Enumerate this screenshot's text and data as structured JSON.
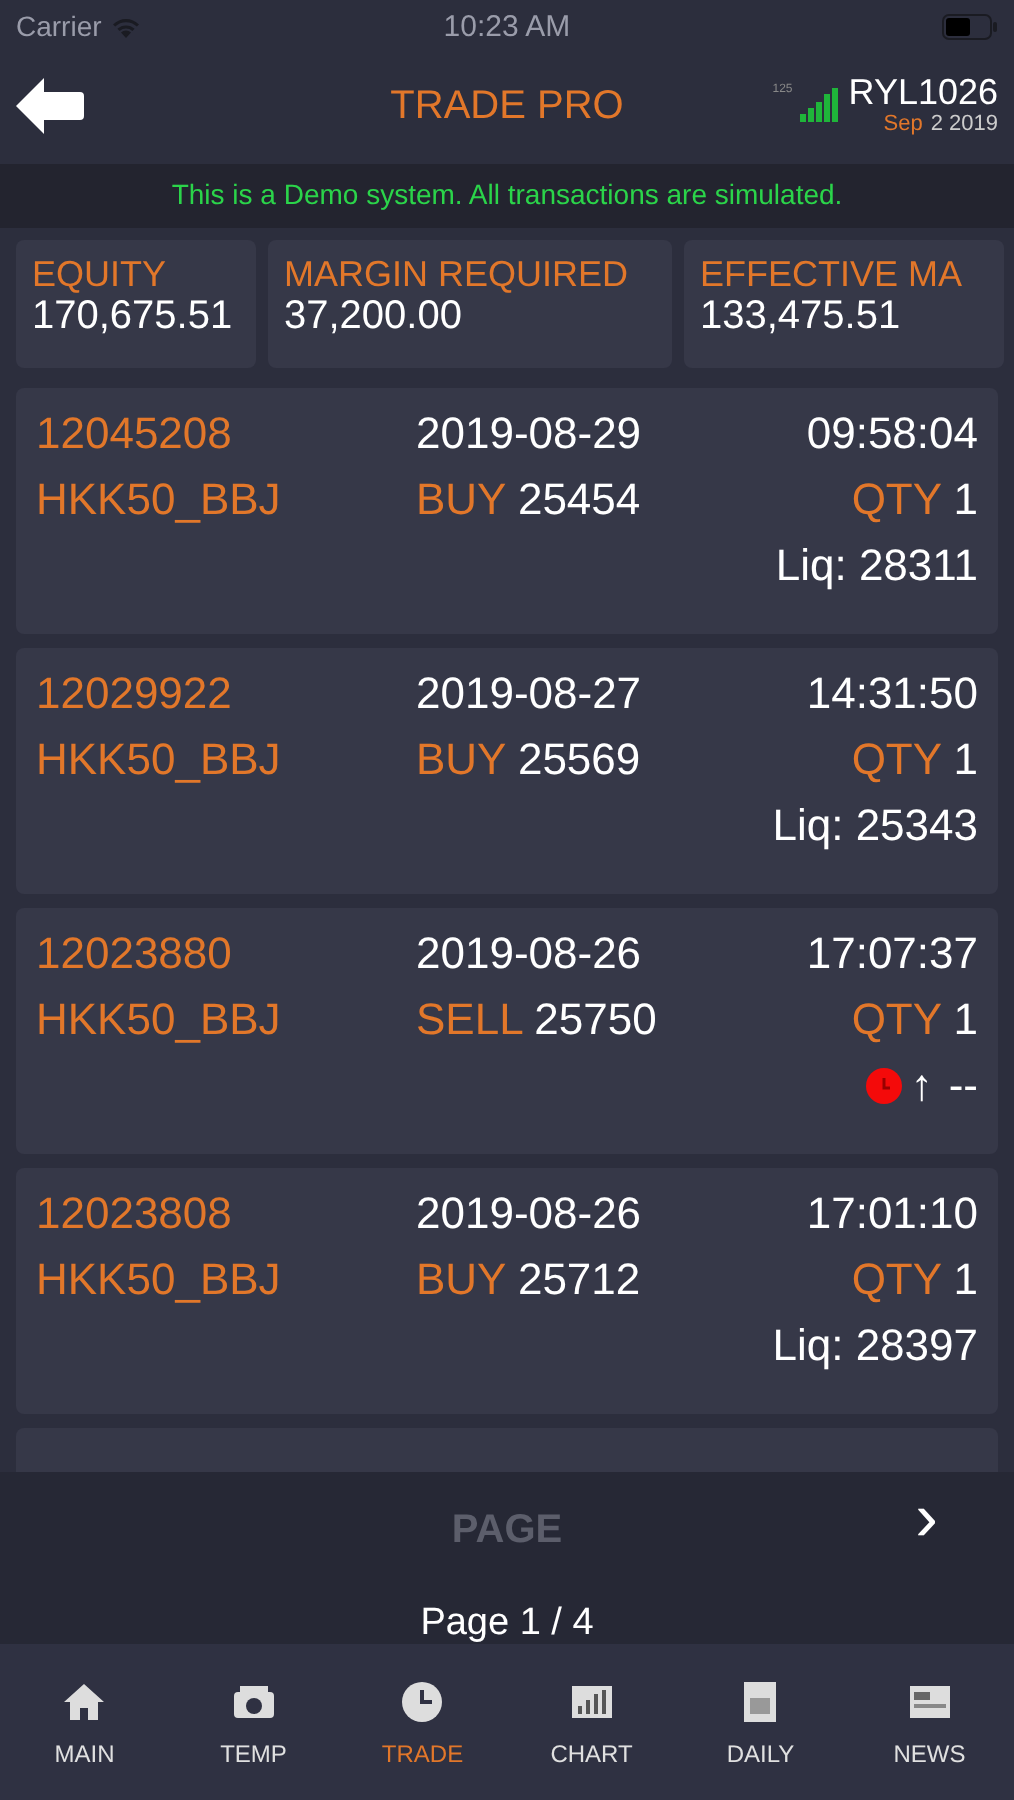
{
  "status_bar": {
    "carrier": "Carrier",
    "time": "10:23 AM"
  },
  "header": {
    "title": "TRADE PRO",
    "signal_value": "125",
    "account": "RYL1026",
    "date_month": "Sep",
    "date_rest": "2 2019"
  },
  "banner": "This is a Demo system. All transactions are simulated.",
  "summary": [
    {
      "label": "EQUITY",
      "value": "170,675.51"
    },
    {
      "label": "MARGIN REQUIRED",
      "value": "37,200.00"
    },
    {
      "label": "EFFECTIVE MA",
      "value": "133,475.51"
    }
  ],
  "trades": [
    {
      "id": "12045208",
      "date": "2019-08-29",
      "time": "09:58:04",
      "symbol": "HKK50_BBJ",
      "side": "BUY",
      "price": "25454",
      "qty_label": "QTY",
      "qty": "1",
      "kind": "liq",
      "liq": "Liq: 28311"
    },
    {
      "id": "12029922",
      "date": "2019-08-27",
      "time": "14:31:50",
      "symbol": "HKK50_BBJ",
      "side": "BUY",
      "price": "25569",
      "qty_label": "QTY",
      "qty": "1",
      "kind": "liq",
      "liq": "Liq: 25343"
    },
    {
      "id": "12023880",
      "date": "2019-08-26",
      "time": "17:07:37",
      "symbol": "HKK50_BBJ",
      "side": "SELL",
      "price": "25750",
      "qty_label": "QTY",
      "qty": "1",
      "kind": "pending",
      "arrow": "↑",
      "liq": "--"
    },
    {
      "id": "12023808",
      "date": "2019-08-26",
      "time": "17:01:10",
      "symbol": "HKK50_BBJ",
      "side": "BUY",
      "price": "25712",
      "qty_label": "QTY",
      "qty": "1",
      "kind": "liq",
      "liq": "Liq: 28397"
    },
    {
      "kind": "partial"
    }
  ],
  "pager": {
    "label": "PAGE",
    "page": "Page 1 / 4",
    "next": "›"
  },
  "tabs": [
    {
      "label": "MAIN",
      "kind": "home",
      "selected": false
    },
    {
      "label": "TEMP",
      "kind": "temp",
      "selected": false
    },
    {
      "label": "TRADE",
      "kind": "clock",
      "selected": true
    },
    {
      "label": "CHART",
      "kind": "chart",
      "selected": false
    },
    {
      "label": "DAILY",
      "kind": "daily",
      "selected": false
    },
    {
      "label": "NEWS",
      "kind": "news",
      "selected": false
    }
  ]
}
